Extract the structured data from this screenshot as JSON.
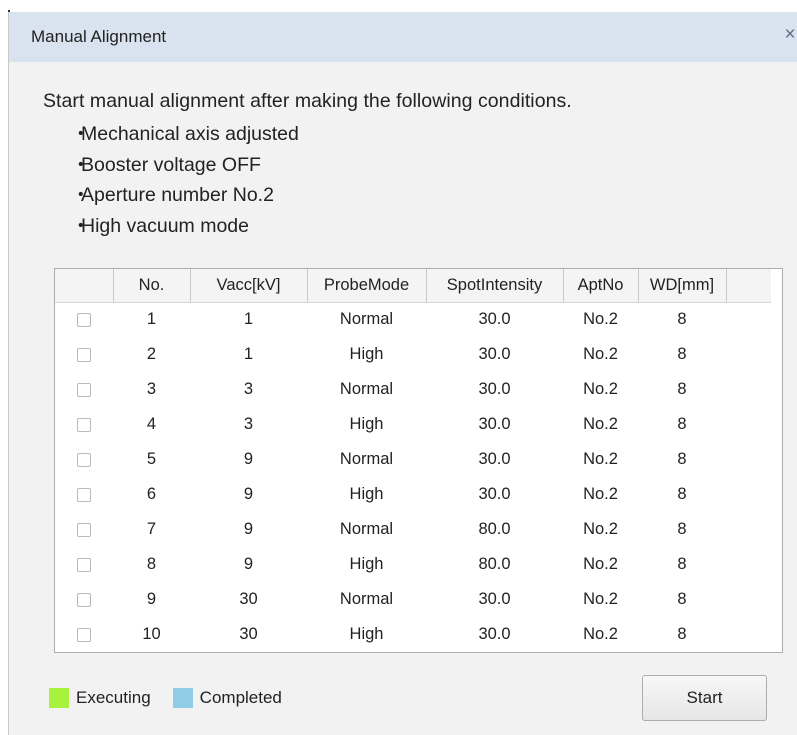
{
  "window": {
    "title": "Manual Alignment",
    "close_glyph": "×"
  },
  "instructions": {
    "intro": "Start manual alignment after making the following conditions.",
    "bullet_glyph": "・",
    "conditions": [
      "Mechanical axis adjusted",
      "Booster voltage OFF",
      "Aperture number No.2",
      "High vacuum mode"
    ]
  },
  "table": {
    "headers": [
      "No.",
      "Vacc[kV]",
      "ProbeMode",
      "SpotIntensity",
      "AptNo",
      "WD[mm]"
    ],
    "rows": [
      {
        "no": "1",
        "vacc": "1",
        "probe": "Normal",
        "spot": "30.0",
        "apt": "No.2",
        "wd": "8"
      },
      {
        "no": "2",
        "vacc": "1",
        "probe": "High",
        "spot": "30.0",
        "apt": "No.2",
        "wd": "8"
      },
      {
        "no": "3",
        "vacc": "3",
        "probe": "Normal",
        "spot": "30.0",
        "apt": "No.2",
        "wd": "8"
      },
      {
        "no": "4",
        "vacc": "3",
        "probe": "High",
        "spot": "30.0",
        "apt": "No.2",
        "wd": "8"
      },
      {
        "no": "5",
        "vacc": "9",
        "probe": "Normal",
        "spot": "30.0",
        "apt": "No.2",
        "wd": "8"
      },
      {
        "no": "6",
        "vacc": "9",
        "probe": "High",
        "spot": "30.0",
        "apt": "No.2",
        "wd": "8"
      },
      {
        "no": "7",
        "vacc": "9",
        "probe": "Normal",
        "spot": "80.0",
        "apt": "No.2",
        "wd": "8"
      },
      {
        "no": "8",
        "vacc": "9",
        "probe": "High",
        "spot": "80.0",
        "apt": "No.2",
        "wd": "8"
      },
      {
        "no": "9",
        "vacc": "30",
        "probe": "Normal",
        "spot": "30.0",
        "apt": "No.2",
        "wd": "8"
      },
      {
        "no": "10",
        "vacc": "30",
        "probe": "High",
        "spot": "30.0",
        "apt": "No.2",
        "wd": "8"
      }
    ]
  },
  "legend": {
    "executing_label": "Executing",
    "executing_color": "#a6f23c",
    "completed_label": "Completed",
    "completed_color": "#8fcde6"
  },
  "buttons": {
    "start_label": "Start"
  }
}
